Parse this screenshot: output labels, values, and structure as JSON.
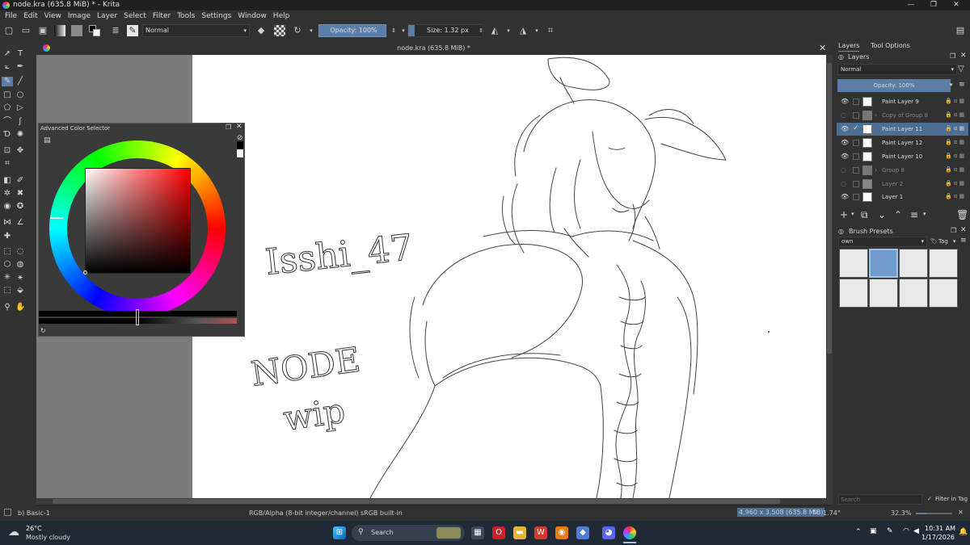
{
  "window": {
    "title": "node.kra (635.8 MiB) * - Krita"
  },
  "menu": [
    "File",
    "Edit",
    "View",
    "Image",
    "Layer",
    "Select",
    "Filter",
    "Tools",
    "Settings",
    "Window",
    "Help"
  ],
  "toolbar": {
    "blend_mode": "Normal",
    "opacity": "Opacity: 100%",
    "size": "Size: 1.32 px"
  },
  "document": {
    "tab_title": "node.kra (635.8 MiB) *"
  },
  "canvas_text": {
    "signature": "Isshi_47",
    "note1": "NODE",
    "note2": "wip"
  },
  "color_selector": {
    "title": "Advanced Color Selector"
  },
  "right_dock": {
    "tabs": [
      "Layers",
      "Tool Options"
    ],
    "layers_title": "Layers",
    "blend_mode": "Normal",
    "opacity": "Opacity:  100%",
    "layers": [
      {
        "name": "Paint Layer 9",
        "visible": true,
        "active": false,
        "dim": false
      },
      {
        "name": "Copy of Group 8",
        "visible": false,
        "active": false,
        "dim": true
      },
      {
        "name": "Paint Layer 11",
        "visible": true,
        "active": true,
        "dim": false
      },
      {
        "name": "Paint Layer 12",
        "visible": true,
        "active": false,
        "dim": false
      },
      {
        "name": "Paint Layer 10",
        "visible": true,
        "active": false,
        "dim": false
      },
      {
        "name": "Group 8",
        "visible": false,
        "active": false,
        "dim": true
      },
      {
        "name": "Layer 2",
        "visible": false,
        "active": false,
        "dim": true
      },
      {
        "name": "Layer 1",
        "visible": true,
        "active": false,
        "dim": false
      }
    ],
    "brush_presets_title": "Brush Presets",
    "brush_filter": "own",
    "tag_label": "Tag",
    "search_placeholder": "Search",
    "filter_in_tag": "Filter in Tag"
  },
  "status": {
    "brush": "b) Basic-1",
    "color_space": "RGB/Alpha (8-bit integer/channel)  sRGB built-in",
    "dimensions": "4,960 x 3,508 (635.8 MiB)",
    "rotation": "1.74°",
    "zoom": "32.3%"
  },
  "taskbar": {
    "weather_temp": "26°C",
    "weather_desc": "Mostly cloudy",
    "search": "Search",
    "time": "10:31 AM",
    "date": "1/17/2026"
  }
}
